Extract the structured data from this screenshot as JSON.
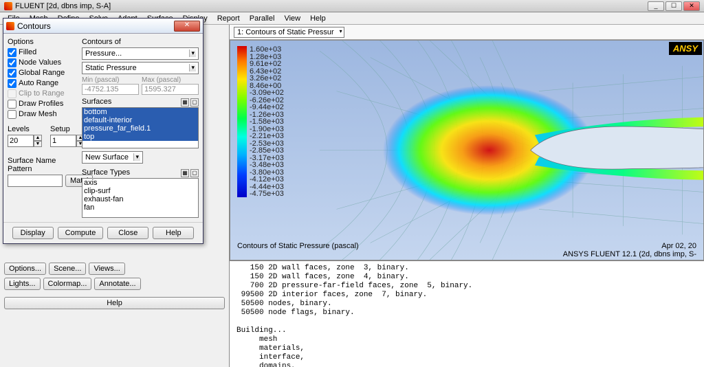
{
  "main": {
    "title": "FLUENT  [2d, dbns imp, S-A]",
    "menu": [
      "File",
      "Mesh",
      "Define",
      "Solve",
      "Adapt",
      "Surface",
      "Display",
      "Report",
      "Parallel",
      "View",
      "Help"
    ],
    "winbtns": {
      "min": "_",
      "max": "☐",
      "close": "✕"
    }
  },
  "viz": {
    "selector": "1: Contours of Static Pressur",
    "footer_left": "Contours of Static Pressure (pascal)",
    "footer_date": "Apr 02, 20",
    "footer_app": "ANSYS FLUENT 12.1 (2d, dbns imp, S-",
    "ansys": "ANSY"
  },
  "chart_data": {
    "type": "contour-colormap",
    "title": "Contours of Static Pressure (pascal)",
    "unit": "pascal",
    "colorbar_levels": [
      "1.60e+03",
      "1.28e+03",
      "9.61e+02",
      "6.43e+02",
      "3.26e+02",
      "8.46e+00",
      "-3.09e+02",
      "-6.26e+02",
      "-9.44e+02",
      "-1.26e+03",
      "-1.58e+03",
      "-1.90e+03",
      "-2.21e+03",
      "-2.53e+03",
      "-2.85e+03",
      "-3.17e+03",
      "-3.48e+03",
      "-3.80e+03",
      "-4.12e+03",
      "-4.44e+03",
      "-4.75e+03"
    ],
    "value_range": [
      -4752.135,
      1595.327
    ]
  },
  "leftpanel": {
    "row1": [
      "Options...",
      "Scene...",
      "Views..."
    ],
    "row2": [
      "Lights...",
      "Colormap...",
      "Annotate..."
    ],
    "help": "Help"
  },
  "console_text": "   150 2D wall faces, zone  3, binary.\n   150 2D wall faces, zone  4, binary.\n   700 2D pressure-far-field faces, zone  5, binary.\n 99500 2D interior faces, zone  7, binary.\n 50500 nodes, binary.\n 50500 node flags, binary.\n\nBuilding...\n     mesh\n     materials,\n     interface,\n     domains,\n        mixture\n     zones,",
  "dialog": {
    "title": "Contours",
    "options_label": "Options",
    "checks": {
      "filled": "Filled",
      "node_values": "Node Values",
      "global_range": "Global Range",
      "auto_range": "Auto Range",
      "clip_to_range": "Clip to Range",
      "draw_profiles": "Draw Profiles",
      "draw_mesh": "Draw Mesh"
    },
    "levels_label": "Levels",
    "levels_value": "20",
    "setup_label": "Setup",
    "setup_value": "1",
    "pattern_label": "Surface Name Pattern",
    "match_btn": "Match",
    "contours_of_label": "Contours of",
    "combo1": "Pressure...",
    "combo2": "Static Pressure",
    "min_label": "Min (pascal)",
    "min_value": "-4752.135",
    "max_label": "Max (pascal)",
    "max_value": "1595.327",
    "surfaces_label": "Surfaces",
    "surfaces": [
      "bottom",
      "default-interior",
      "pressure_far_field.1",
      "top"
    ],
    "new_surface": "New Surface",
    "surface_types_label": "Surface Types",
    "surface_types": [
      "axis",
      "clip-surf",
      "exhaust-fan",
      "fan"
    ],
    "buttons": {
      "display": "Display",
      "compute": "Compute",
      "close": "Close",
      "help": "Help"
    }
  }
}
